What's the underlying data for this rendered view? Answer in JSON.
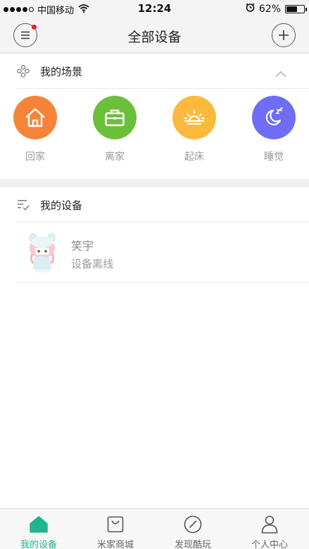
{
  "status_bar": {
    "carrier": "中国移动",
    "time": "12:24",
    "battery_percent": "62%",
    "battery_level": 0.62
  },
  "nav": {
    "title": "全部设备"
  },
  "scenes_section": {
    "title": "我的场景",
    "items": [
      {
        "label": "回家",
        "color": "#f5843a",
        "icon": "home-icon"
      },
      {
        "label": "离家",
        "color": "#6cbf3a",
        "icon": "briefcase-icon"
      },
      {
        "label": "起床",
        "color": "#fdb93c",
        "icon": "sunrise-icon"
      },
      {
        "label": "睡觉",
        "color": "#6f6df5",
        "icon": "moon-icon"
      }
    ]
  },
  "devices_section": {
    "title": "我的设备",
    "devices": [
      {
        "name": "笑宇",
        "status": "设备离线",
        "icon": "bunny-robot-icon"
      }
    ]
  },
  "tabs": [
    {
      "label": "我的设备",
      "icon": "house-icon",
      "active": true
    },
    {
      "label": "米家商城",
      "icon": "shopping-bag-icon",
      "active": false
    },
    {
      "label": "发现酷玩",
      "icon": "compass-icon",
      "active": false
    },
    {
      "label": "个人中心",
      "icon": "person-icon",
      "active": false
    }
  ],
  "colors": {
    "accent": "#21b58d",
    "notification": "#e8231b"
  }
}
